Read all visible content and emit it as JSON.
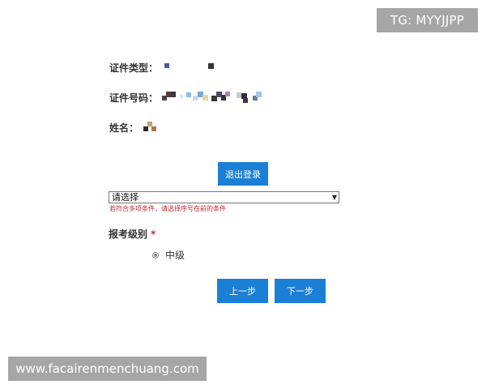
{
  "watermarks": {
    "top": "TG: MYYJJPP",
    "bottom": "www.facairenmenchuang.com"
  },
  "info": {
    "id_type_label": "证件类型：",
    "id_number_label": "证件号码：",
    "name_label": "姓名："
  },
  "buttons": {
    "logout": "退出登录",
    "prev": "上一步",
    "next": "下一步"
  },
  "select": {
    "value": "请选择",
    "hint": "若符合多项条件，请选择序号在前的条件"
  },
  "exam_level": {
    "label": "报考级别",
    "required_mark": "*",
    "options": [
      {
        "label": "中级",
        "selected": true
      }
    ]
  },
  "colors": {
    "primary_button": "#1b7fd6",
    "hint_text": "#c0282d",
    "watermark_bg": "#a6a6a6"
  }
}
